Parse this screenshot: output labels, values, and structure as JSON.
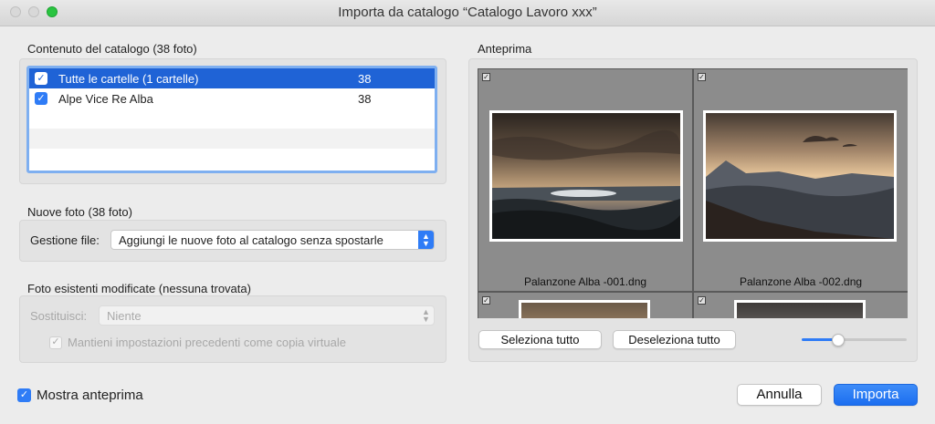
{
  "window": {
    "title": "Importa da catalogo “Catalogo Lavoro xxx”"
  },
  "catalog_content": {
    "label": "Contenuto del catalogo (38 foto)",
    "rows": [
      {
        "label": "Tutte le cartelle (1 cartelle)",
        "count": "38",
        "checked": true,
        "selected": true
      },
      {
        "label": "Alpe Vice Re Alba",
        "count": "38",
        "checked": true,
        "selected": false
      }
    ]
  },
  "new_photos": {
    "label": "Nuove foto (38 foto)",
    "management_label": "Gestione file:",
    "management_value": "Aggiungi le nuove foto al catalogo senza spostarle"
  },
  "modified_photos": {
    "label": "Foto esistenti modificate (nessuna trovata)",
    "replace_label": "Sostituisci:",
    "replace_value": "Niente",
    "keep_settings_label": "Mantieni impostazioni precedenti come copia virtuale",
    "keep_settings_checked": true
  },
  "preview": {
    "label": "Anteprima",
    "items": [
      {
        "name": "Palanzone Alba -001.dng",
        "checked": true
      },
      {
        "name": "Palanzone Alba -002.dng",
        "checked": true
      }
    ],
    "select_all_label": "Seleziona tutto",
    "deselect_all_label": "Deseleziona tutto",
    "thumbnail_size_fraction": 0.33
  },
  "footer": {
    "show_preview_label": "Mostra anteprima",
    "show_preview_checked": true,
    "cancel_label": "Annulla",
    "import_label": "Importa"
  },
  "colors": {
    "accent": "#2f7cf6",
    "selection": "#1f63d6"
  },
  "icons": {
    "check": "checkmark-icon",
    "stepper": "chevron-updown-icon"
  }
}
